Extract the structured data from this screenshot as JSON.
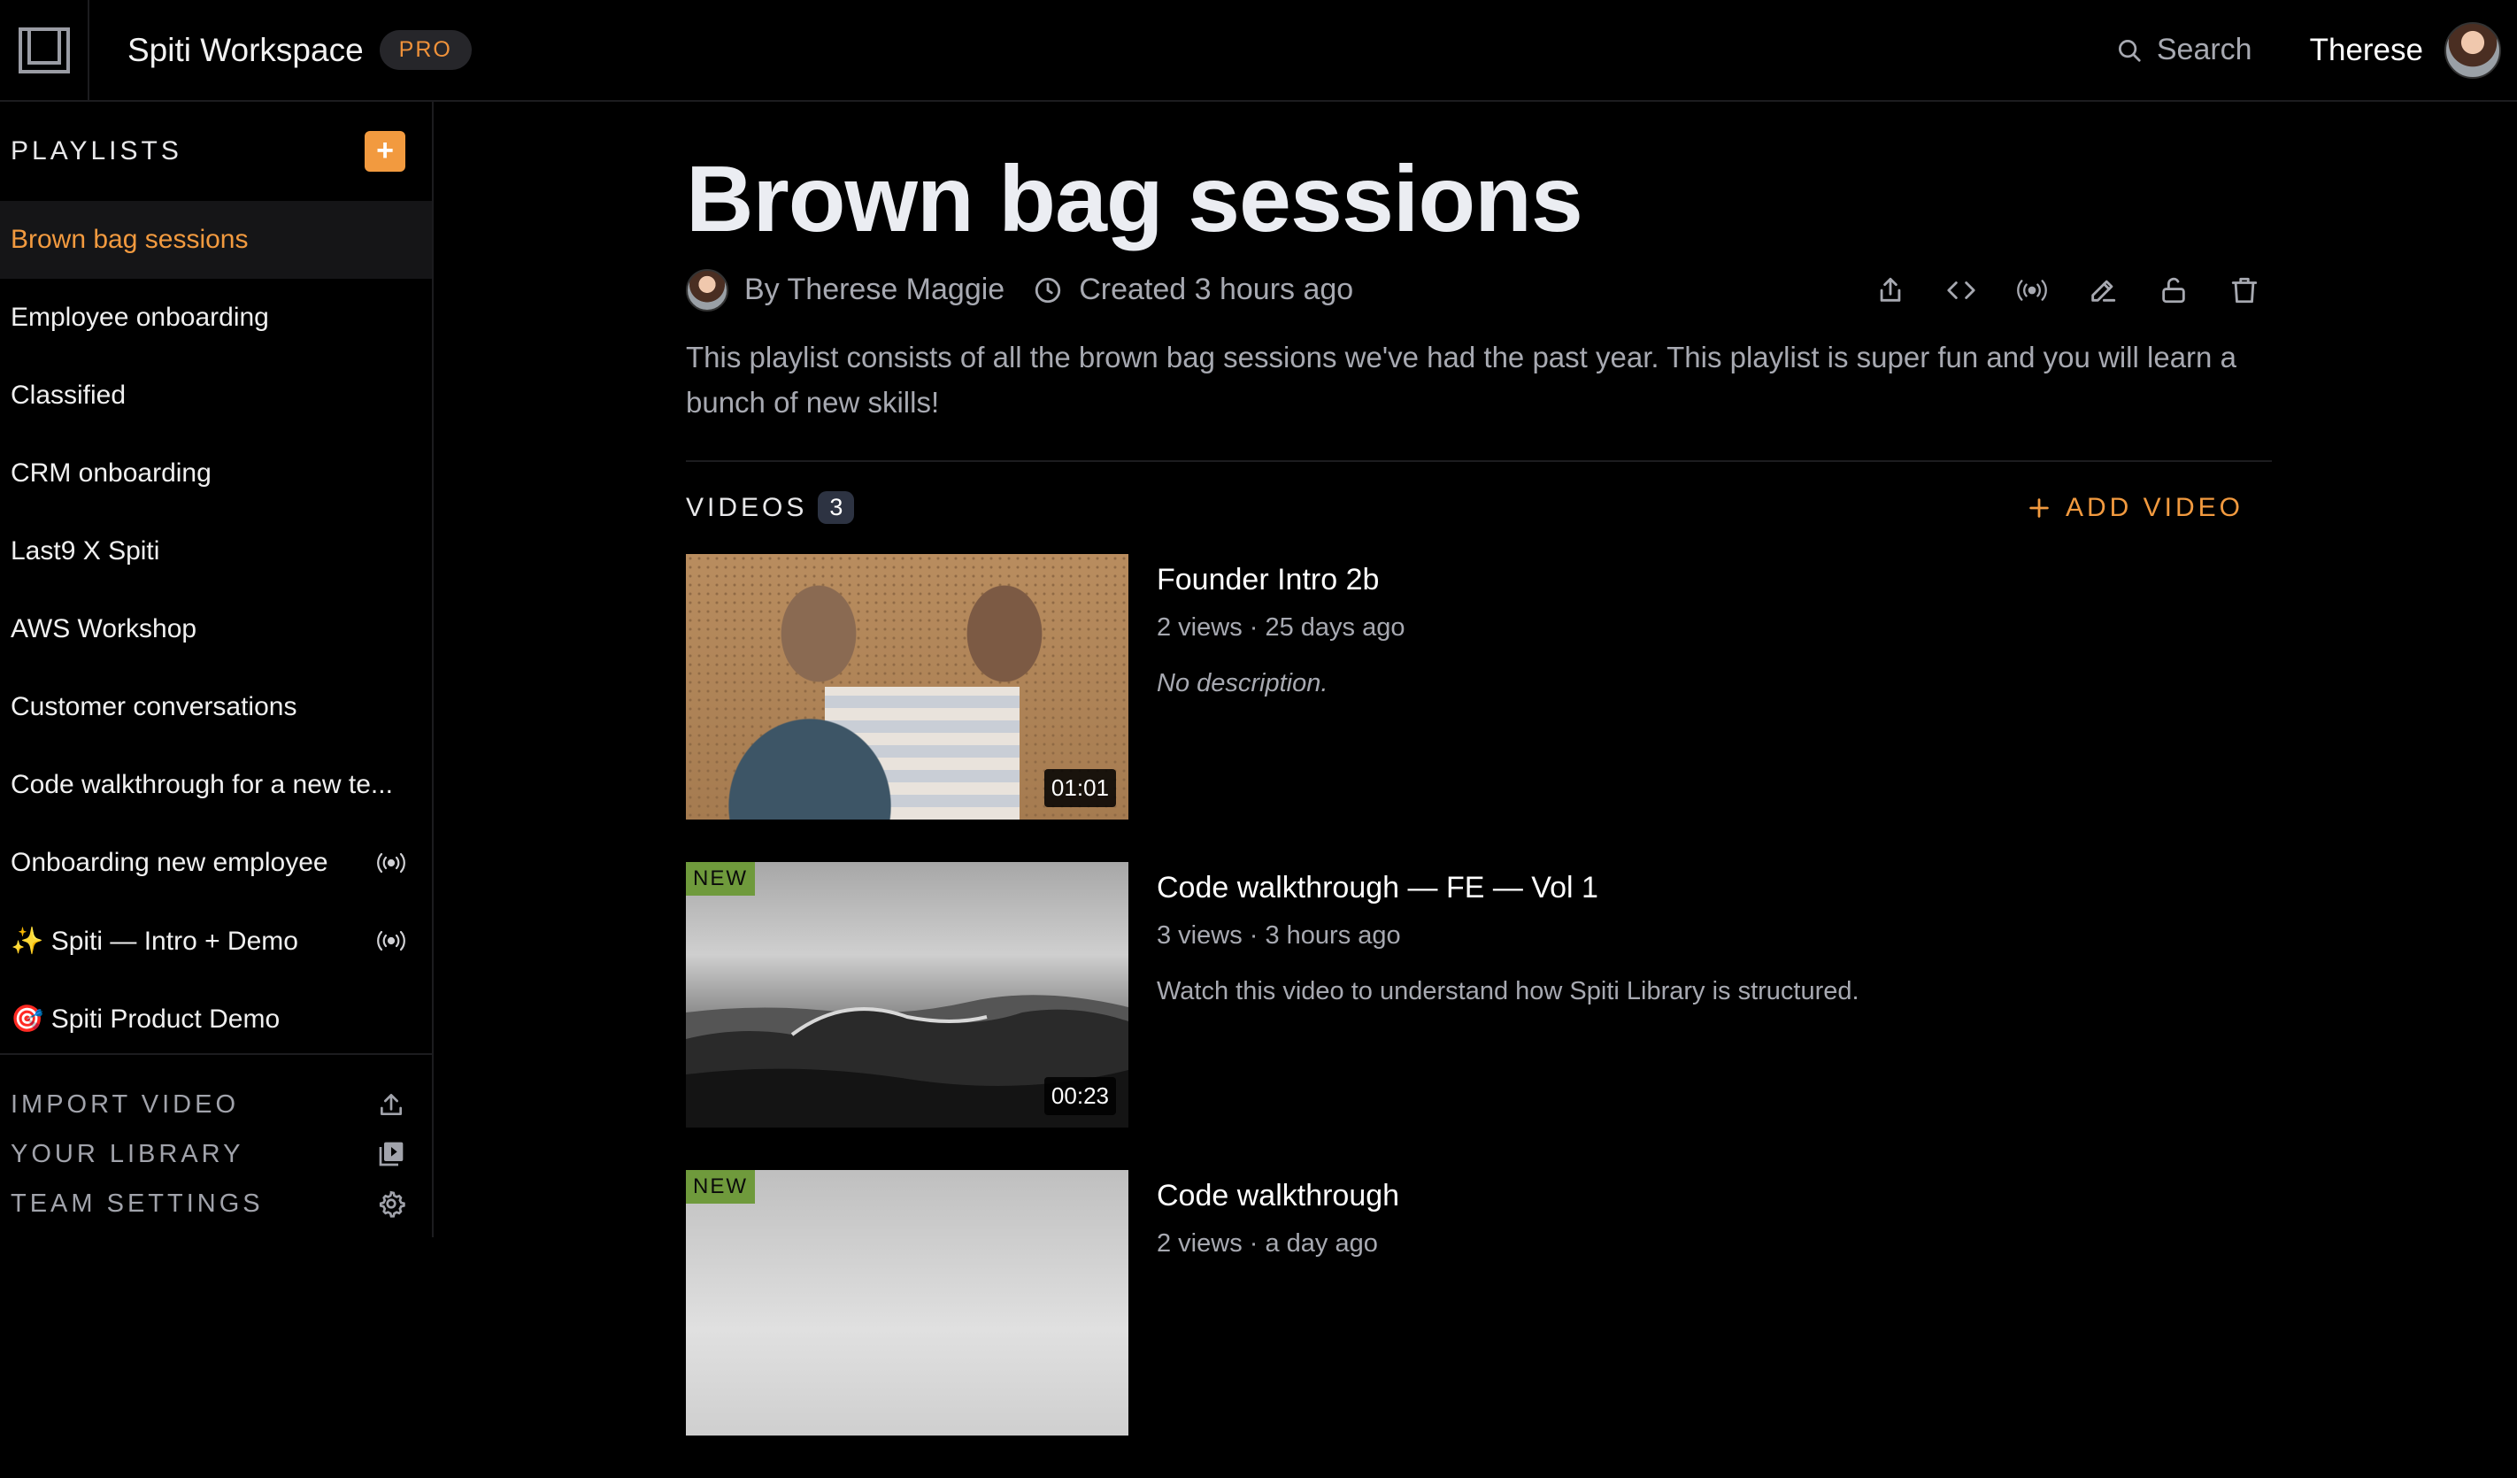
{
  "topbar": {
    "workspace_name": "Spiti Workspace",
    "plan_badge": "PRO",
    "search_label": "Search",
    "user_name": "Therese"
  },
  "sidebar": {
    "heading": "PLAYLISTS",
    "add_label": "+",
    "items": [
      {
        "label": "Brown bag sessions",
        "active": true,
        "live": false
      },
      {
        "label": "Employee onboarding",
        "active": false,
        "live": false
      },
      {
        "label": "Classified",
        "active": false,
        "live": false
      },
      {
        "label": "CRM onboarding",
        "active": false,
        "live": false
      },
      {
        "label": "Last9 X Spiti",
        "active": false,
        "live": false
      },
      {
        "label": "AWS Workshop",
        "active": false,
        "live": false
      },
      {
        "label": "Customer conversations",
        "active": false,
        "live": false
      },
      {
        "label": "Code walkthrough for a new te...",
        "active": false,
        "live": false
      },
      {
        "label": "Onboarding new employee",
        "active": false,
        "live": true
      },
      {
        "label": "✨ Spiti — Intro + Demo",
        "active": false,
        "live": true
      },
      {
        "label": "🎯 Spiti Product Demo",
        "active": false,
        "live": false
      }
    ],
    "footer": {
      "import": "IMPORT VIDEO",
      "library": "YOUR LIBRARY",
      "settings": "TEAM SETTINGS"
    }
  },
  "playlist": {
    "title": "Brown bag sessions",
    "author": "By Therese Maggie",
    "created": "Created 3 hours ago",
    "description": "This playlist consists of all the brown bag sessions we've had the past year. This playlist is super fun and you will learn a bunch of new skills!",
    "videos_label": "VIDEOS",
    "videos_count": "3",
    "add_video_label": "ADD VIDEO"
  },
  "videos": [
    {
      "title": "Founder Intro 2b",
      "meta": "2 views · 25 days ago",
      "description": "No description.",
      "duration": "01:01",
      "badge": ""
    },
    {
      "title": "Code walkthrough — FE — Vol 1",
      "meta": "3 views · 3 hours ago",
      "description": "Watch this video to understand how Spiti Library is structured.",
      "duration": "00:23",
      "badge": "NEW"
    },
    {
      "title": "Code walkthrough",
      "meta": "2 views · a day ago",
      "description": "",
      "duration": "",
      "badge": "NEW"
    }
  ],
  "colors": {
    "accent": "#f29a3f",
    "background": "#000000",
    "muted_text": "#a7a9b1",
    "new_badge": "#6f9a3c"
  }
}
